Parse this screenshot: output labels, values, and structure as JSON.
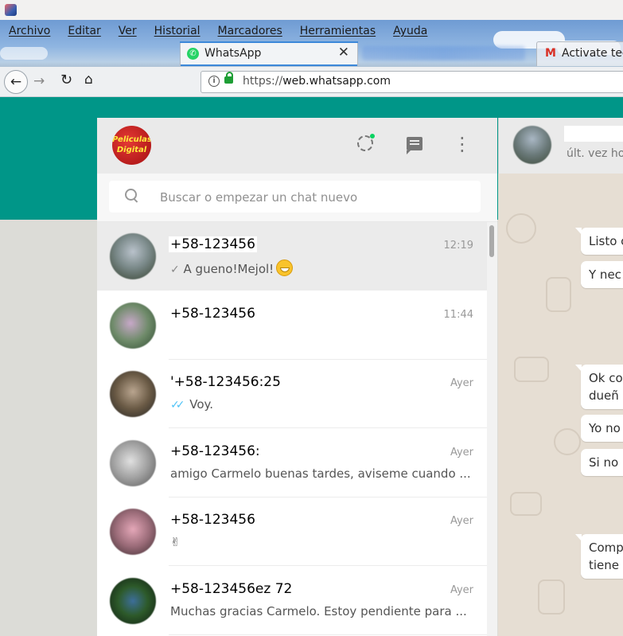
{
  "browser": {
    "menu": [
      "Archivo",
      "Editar",
      "Ver",
      "Historial",
      "Marcadores",
      "Herramientas",
      "Ayuda"
    ],
    "tabs": [
      {
        "title": "WhatsApp",
        "active": true
      },
      {
        "title": "Activate tec",
        "active": false
      }
    ],
    "url": {
      "scheme": "https://",
      "host": "web.whatsapp.com"
    }
  },
  "whatsapp": {
    "my_avatar_text": "Peliculas Digital",
    "search": {
      "placeholder": "Buscar o empezar un chat nuevo"
    },
    "chats": [
      {
        "name": "+58-123456",
        "time": "12:19",
        "preview": "A gueno!Mejol!",
        "tick": "✓",
        "selected": true,
        "avatar": "radial-gradient(circle at 50% 40%,#b9c2cb 0%,#7b8a8a 45%,#34402e 100%)"
      },
      {
        "name": "+58-123456",
        "time": "11:44",
        "preview": "",
        "tick": "",
        "selected": false,
        "avatar": "radial-gradient(circle at 45% 45%,#c7a8c8 0%,#6f8b6a 50%,#2e4a30 100%)"
      },
      {
        "name": "'+58-123456:25",
        "time": "Ayer",
        "preview": "Voy.",
        "tick": "✓✓",
        "selected": false,
        "avatar": "radial-gradient(circle at 50% 45%,#b9a58f 0%,#6a5a45 50%,#222 100%)"
      },
      {
        "name": "+58-123456:",
        "time": "Ayer",
        "preview": "amigo Carmelo buenas tardes, aviseme cuando ...",
        "tick": "",
        "selected": false,
        "avatar": "radial-gradient(circle at 45% 45%,#e0e0e0 0%,#9e9e9e 50%,#555 100%)"
      },
      {
        "name": "+58-123456",
        "time": "Ayer",
        "preview": "✌",
        "tick": "",
        "selected": false,
        "avatar": "radial-gradient(circle at 50% 45%,#e4a7b8 0%,#9a6b78 50%,#3a2a2e 100%)"
      },
      {
        "name": "+58-123456ez 72",
        "time": "Ayer",
        "preview": "Muchas gracias Carmelo. Estoy pendiente para ...",
        "tick": "",
        "selected": false,
        "avatar": "radial-gradient(circle at 50% 50%,#3d6e9a 0%,#2d5a2a 45%,#0e1a10 100%)"
      }
    ],
    "contact": {
      "status": "últ. vez ho"
    },
    "messages": [
      "Listo c",
      "Y nec",
      "Ok co",
      "dueñ",
      "Yo no",
      "Si no",
      "Comp",
      "tiene"
    ]
  }
}
